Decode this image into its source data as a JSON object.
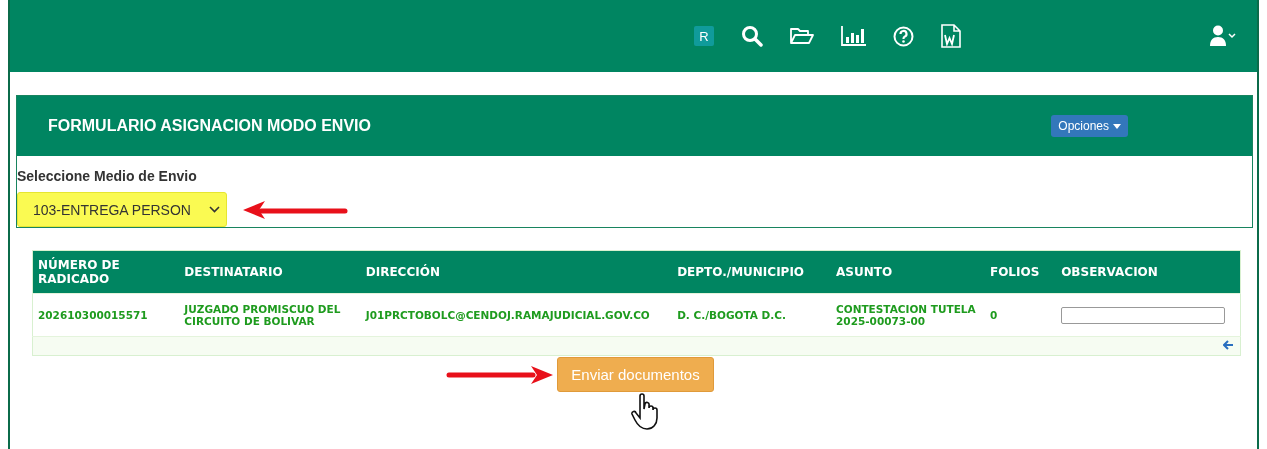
{
  "toolbar": {
    "badge": "R",
    "icons": [
      {
        "kind": "search"
      },
      {
        "kind": "folder"
      },
      {
        "kind": "chart"
      },
      {
        "kind": "help"
      },
      {
        "kind": "word"
      }
    ]
  },
  "panel": {
    "title": "FORMULARIO ASIGNACION MODO ENVIO",
    "options_button": "Opciones",
    "field_label": "Seleccione Medio de Envio",
    "select_value": "103-ENTREGA PERSON",
    "select_highlighted": true
  },
  "table": {
    "columns": [
      "NÚMERO DE RADICADO",
      "DESTINATARIO",
      "DIRECCIÓN",
      "DEPTO./MUNICIPIO",
      "ASUNTO",
      "FOLIOS",
      "OBSERVACION"
    ],
    "rows": [
      {
        "cells": [
          "202610300015571",
          "JUZGADO PROMISCUO DEL CIRCUITO DE BOLIVAR",
          "J01PRCTOBOLC@CENDOJ.RAMAJUDICIAL.GOV.CO",
          "D. C./BOGOTA D.C.",
          "CONTESTACION TUTELA 2025-00073-00",
          "0"
        ]
      }
    ]
  },
  "submit_button": "Enviar documentos"
}
